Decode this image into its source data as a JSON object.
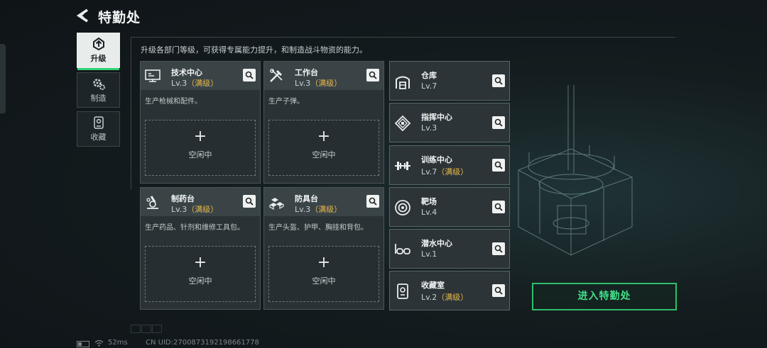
{
  "header": {
    "title": "特勤处"
  },
  "side_tabs": [
    {
      "label": "升级",
      "icon": "upgrade-icon",
      "active": true
    },
    {
      "label": "制造",
      "icon": "gear-icon",
      "active": false
    },
    {
      "label": "收藏",
      "icon": "trophy-icon",
      "active": false
    }
  ],
  "description": "升级各部门等级，可获得专属能力提升，和制造战斗物资的能力。",
  "cards": [
    {
      "name": "技术中心",
      "level": "Lv.3",
      "maxed": "（满级）",
      "desc": "生产枪械和配件。",
      "slot_plus": "+",
      "slot_status": "空闲中",
      "icon": "computer-icon"
    },
    {
      "name": "工作台",
      "level": "Lv.3",
      "maxed": "（满级）",
      "desc": "生产子弹。",
      "slot_plus": "+",
      "slot_status": "空闲中",
      "icon": "tools-icon"
    },
    {
      "name": "制药台",
      "level": "Lv.3",
      "maxed": "（满级）",
      "desc": "生产药品、针剂和维修工具包。",
      "slot_plus": "+",
      "slot_status": "空闲中",
      "icon": "microscope-icon"
    },
    {
      "name": "防具台",
      "level": "Lv.3",
      "maxed": "（满级）",
      "desc": "生产头盔、护甲、胸挂和背包。",
      "slot_plus": "+",
      "slot_status": "空闲中",
      "icon": "armor-blocks-icon"
    }
  ],
  "facilities": [
    {
      "name": "仓库",
      "level": "Lv.7",
      "maxed": "",
      "icon": "warehouse-icon"
    },
    {
      "name": "指挥中心",
      "level": "Lv.3",
      "maxed": "",
      "icon": "command-icon"
    },
    {
      "name": "训练中心",
      "level": "Lv.7",
      "maxed": "（满级）",
      "icon": "dumbbell-icon"
    },
    {
      "name": "靶场",
      "level": "Lv.4",
      "maxed": "",
      "icon": "target-icon"
    },
    {
      "name": "潜水中心",
      "level": "Lv.1",
      "maxed": "",
      "icon": "goggles-icon"
    },
    {
      "name": "收藏室",
      "level": "Lv.2",
      "maxed": "（满级）",
      "icon": "trophy-icon"
    }
  ],
  "enter_button": "进入特勤处",
  "footer": {
    "ping": "52ms",
    "uid": "CN UID:2700873192198661778"
  },
  "colors": {
    "accent_green": "#2fd174",
    "maxed_gold": "#e8b84a"
  }
}
